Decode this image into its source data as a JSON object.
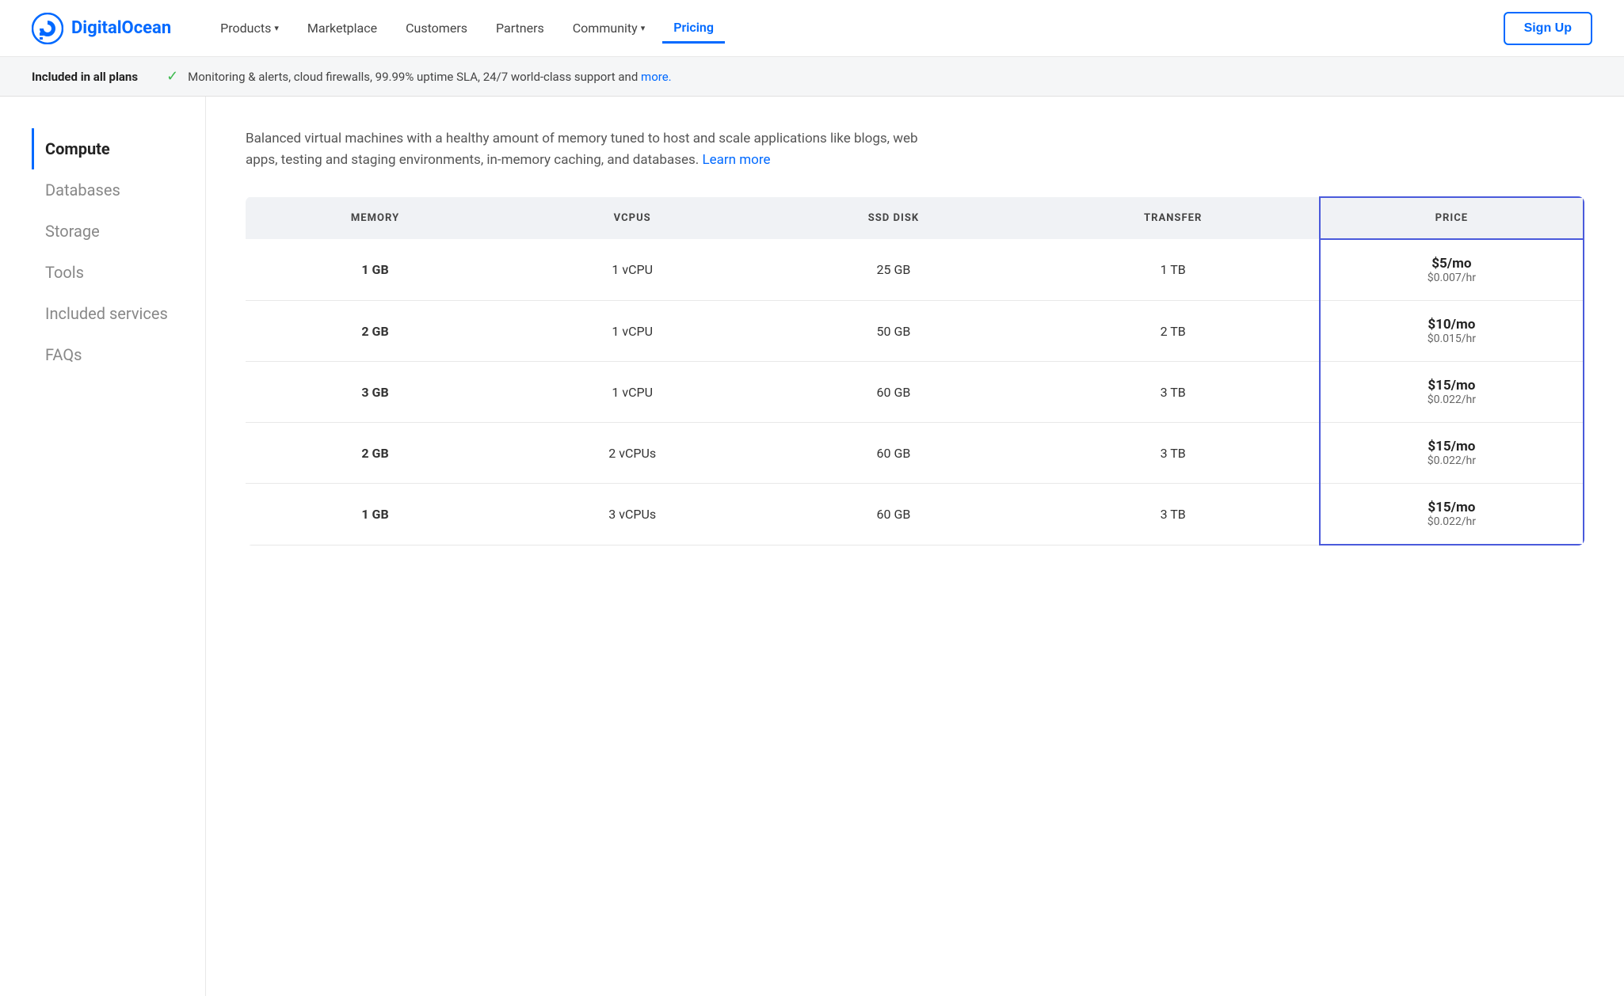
{
  "brand": {
    "name": "DigitalOcean",
    "logo_alt": "DigitalOcean logo"
  },
  "nav": {
    "links": [
      {
        "id": "products",
        "label": "Products",
        "has_chevron": true,
        "active": false
      },
      {
        "id": "marketplace",
        "label": "Marketplace",
        "has_chevron": false,
        "active": false
      },
      {
        "id": "customers",
        "label": "Customers",
        "has_chevron": false,
        "active": false
      },
      {
        "id": "partners",
        "label": "Partners",
        "has_chevron": false,
        "active": false
      },
      {
        "id": "community",
        "label": "Community",
        "has_chevron": true,
        "active": false
      },
      {
        "id": "pricing",
        "label": "Pricing",
        "has_chevron": false,
        "active": true
      }
    ],
    "signup_label": "Sign Up"
  },
  "banner": {
    "label": "Included in all plans",
    "text": "Monitoring & alerts, cloud firewalls, 99.99% uptime SLA, 24/7 world-class support and",
    "link_text": "more.",
    "check_icon": "✓"
  },
  "sidebar": {
    "items": [
      {
        "id": "compute",
        "label": "Compute",
        "active": true
      },
      {
        "id": "databases",
        "label": "Databases",
        "active": false
      },
      {
        "id": "storage",
        "label": "Storage",
        "active": false
      },
      {
        "id": "tools",
        "label": "Tools",
        "active": false
      },
      {
        "id": "included-services",
        "label": "Included services",
        "active": false
      },
      {
        "id": "faqs",
        "label": "FAQs",
        "active": false
      }
    ]
  },
  "content": {
    "section_title": "Compute",
    "description": "Balanced virtual machines with a healthy amount of memory tuned to host and scale applications like blogs, web apps, testing and staging environments, in-memory caching, and databases.",
    "learn_more_label": "Learn more",
    "table": {
      "headers": [
        "MEMORY",
        "VCPUS",
        "SSD DISK",
        "TRANSFER",
        "PRICE"
      ],
      "rows": [
        {
          "memory": "1 GB",
          "vcpus": "1 vCPU",
          "ssd_disk": "25 GB",
          "transfer": "1 TB",
          "price_mo": "$5/mo",
          "price_hr": "$0.007/hr"
        },
        {
          "memory": "2 GB",
          "vcpus": "1 vCPU",
          "ssd_disk": "50 GB",
          "transfer": "2 TB",
          "price_mo": "$10/mo",
          "price_hr": "$0.015/hr"
        },
        {
          "memory": "3 GB",
          "vcpus": "1 vCPU",
          "ssd_disk": "60 GB",
          "transfer": "3 TB",
          "price_mo": "$15/mo",
          "price_hr": "$0.022/hr"
        },
        {
          "memory": "2 GB",
          "vcpus": "2 vCPUs",
          "ssd_disk": "60 GB",
          "transfer": "3 TB",
          "price_mo": "$15/mo",
          "price_hr": "$0.022/hr"
        },
        {
          "memory": "1 GB",
          "vcpus": "3 vCPUs",
          "ssd_disk": "60 GB",
          "transfer": "3 TB",
          "price_mo": "$15/mo",
          "price_hr": "$0.022/hr"
        }
      ]
    }
  },
  "colors": {
    "accent": "#0069ff",
    "highlight_border": "#4a5adb",
    "check_green": "#3dba4e"
  }
}
